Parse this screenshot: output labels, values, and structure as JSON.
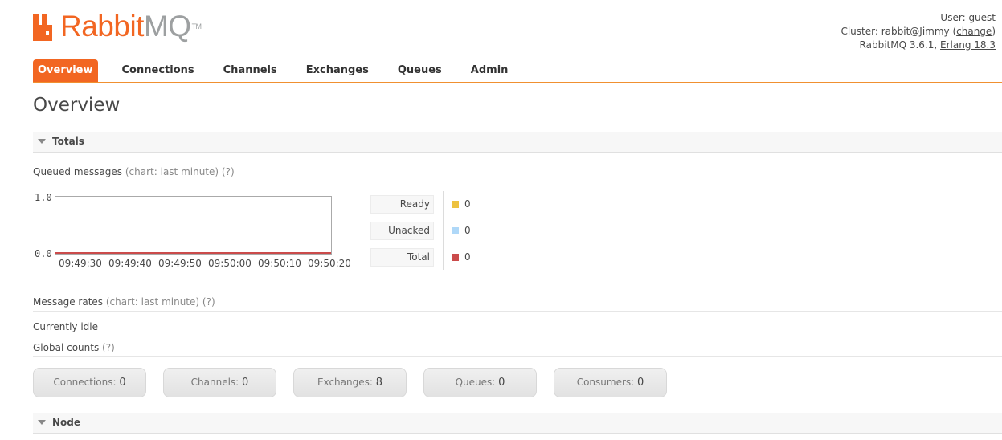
{
  "logo": {
    "part1": "Rabbit",
    "part2": "MQ",
    "tm": "TM"
  },
  "login": {
    "user_label": "User:",
    "user": "guest",
    "cluster_label": "Cluster:",
    "cluster": "rabbit@Jimmy",
    "change": "change",
    "version_text": "RabbitMQ 3.6.1,",
    "erlang": "Erlang 18.3"
  },
  "tabs": [
    "Overview",
    "Connections",
    "Channels",
    "Exchanges",
    "Queues",
    "Admin"
  ],
  "page_title": "Overview",
  "totals": {
    "title": "Totals",
    "queued_label": "Queued messages",
    "queued_note": "(chart: last minute)",
    "help": "(?)",
    "rates_label": "Message rates",
    "rates_note": "(chart: last minute)",
    "idle": "Currently idle",
    "global_label": "Global counts"
  },
  "legend": [
    {
      "label": "Ready",
      "value": "0",
      "color": "#edc240"
    },
    {
      "label": "Unacked",
      "value": "0",
      "color": "#afd8f8"
    },
    {
      "label": "Total",
      "value": "0",
      "color": "#cb4b4b"
    }
  ],
  "counts": [
    {
      "label": "Connections:",
      "value": "0"
    },
    {
      "label": "Channels:",
      "value": "0"
    },
    {
      "label": "Exchanges:",
      "value": "8"
    },
    {
      "label": "Queues:",
      "value": "0"
    },
    {
      "label": "Consumers:",
      "value": "0"
    }
  ],
  "node": {
    "title": "Node"
  },
  "chart_data": {
    "type": "line",
    "title": "",
    "x": [
      "09:49:30",
      "09:49:40",
      "09:49:50",
      "09:50:00",
      "09:50:10",
      "09:50:20"
    ],
    "ytick_labels": [
      "0.0",
      "1.0"
    ],
    "ylim": [
      0,
      1
    ],
    "series": [
      {
        "name": "Ready",
        "values": [
          0,
          0,
          0,
          0,
          0,
          0
        ],
        "color": "#edc240"
      },
      {
        "name": "Unacked",
        "values": [
          0,
          0,
          0,
          0,
          0,
          0
        ],
        "color": "#afd8f8"
      },
      {
        "name": "Total",
        "values": [
          0,
          0,
          0,
          0,
          0,
          0
        ],
        "color": "#cb4b4b"
      }
    ]
  }
}
